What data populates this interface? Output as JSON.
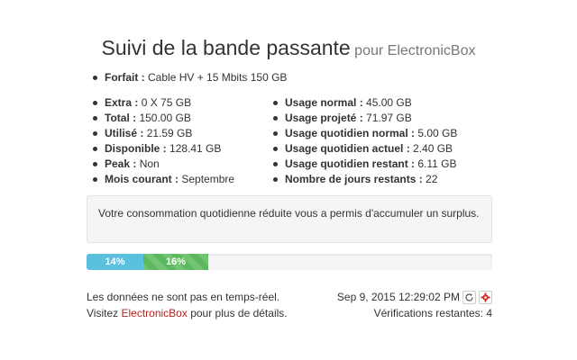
{
  "header": {
    "title": "Suivi de la bande passante",
    "subtitle": "pour ElectronicBox"
  },
  "forfait": {
    "label": "Forfait :",
    "value": "Cable HV + 15 Mbits 150 GB"
  },
  "left_stats": [
    {
      "label": "Extra :",
      "value": "0 X 75 GB"
    },
    {
      "label": "Total :",
      "value": "150.00 GB"
    },
    {
      "label": "Utilisé :",
      "value": "21.59 GB"
    },
    {
      "label": "Disponible :",
      "value": "128.41 GB"
    },
    {
      "label": "Peak :",
      "value": "Non"
    },
    {
      "label": "Mois courant :",
      "value": "Septembre"
    }
  ],
  "right_stats": [
    {
      "label": "Usage normal :",
      "value": "45.00 GB"
    },
    {
      "label": "Usage projeté :",
      "value": "71.97 GB"
    },
    {
      "label": "Usage quotidien normal :",
      "value": "5.00 GB"
    },
    {
      "label": "Usage quotidien actuel :",
      "value": "2.40 GB"
    },
    {
      "label": "Usage quotidien restant :",
      "value": "6.11 GB"
    },
    {
      "label": "Nombre de jours restants :",
      "value": "22"
    }
  ],
  "note": {
    "text": "Votre consommation quotidienne réduite vous a permis d'accumuler un surplus."
  },
  "progress": {
    "used_label": "14%",
    "used_fraction": 0.14,
    "used_color": "#5bc0de",
    "projected_label": "16%",
    "projected_fraction": 0.16,
    "projected_color": "#5cb85c"
  },
  "footer": {
    "realtime_text": "Les données ne sont pas en temps-réel.",
    "visit_prefix": "Visitez",
    "link_text": "ElectronicBox",
    "visit_suffix": "pour plus de détails.",
    "timestamp": "Sep 9, 2015 12:29:02 PM",
    "checks_remaining": "Vérifications restantes: 4",
    "refresh_icon": "refresh-icon",
    "settings_icon": "gear-icon"
  }
}
